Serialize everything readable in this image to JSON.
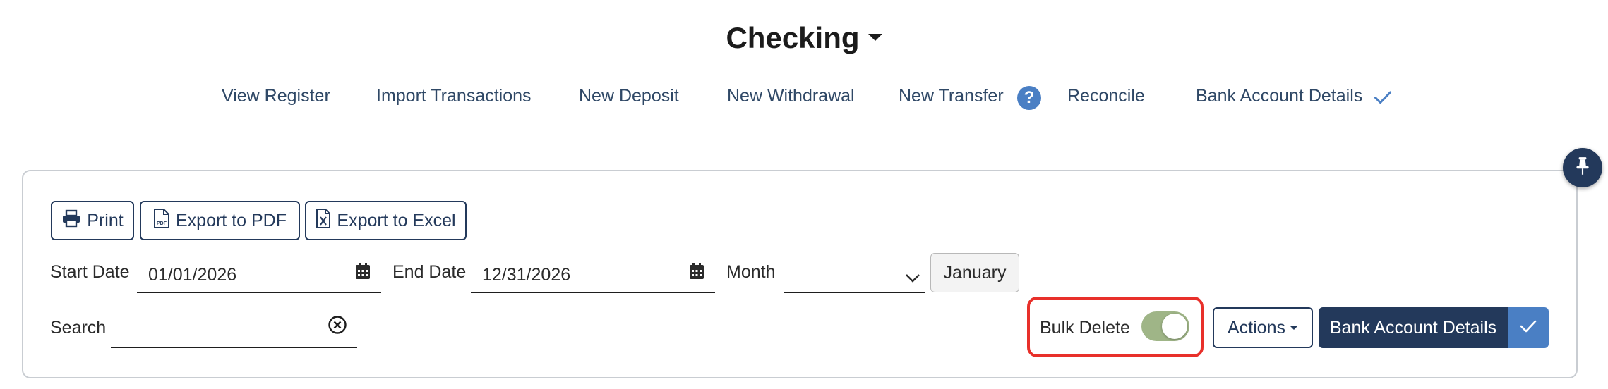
{
  "header": {
    "title": "Checking",
    "nav": [
      {
        "label": "View Register"
      },
      {
        "label": "Import Transactions"
      },
      {
        "label": "New Deposit"
      },
      {
        "label": "New Withdrawal"
      },
      {
        "label": "New Transfer"
      },
      {
        "label": "Reconcile"
      },
      {
        "label": "Bank Account Details"
      }
    ],
    "help_symbol": "?"
  },
  "toolbar": {
    "print_label": "Print",
    "export_pdf_label": "Export to PDF",
    "export_excel_label": "Export to Excel"
  },
  "filters": {
    "start_date_label": "Start Date",
    "start_date_value": "01/01/2026",
    "end_date_label": "End Date",
    "end_date_value": "12/31/2026",
    "month_label": "Month",
    "month_value": "",
    "month_button_label": "January",
    "search_label": "Search",
    "search_value": ""
  },
  "bulk": {
    "label": "Bulk Delete",
    "enabled": true
  },
  "actions": {
    "actions_label": "Actions",
    "bank_details_label": "Bank Account Details"
  },
  "colors": {
    "primary": "#23395b",
    "accent": "#4a7fc4",
    "toggle_on": "#9fb587",
    "highlight": "#e8302a"
  },
  "icons": [
    "caret-down-icon",
    "question-icon",
    "check-icon",
    "pin-icon",
    "printer-icon",
    "pdf-file-icon",
    "excel-file-icon",
    "calendar-icon",
    "chevron-down-icon",
    "clear-circle-icon"
  ]
}
